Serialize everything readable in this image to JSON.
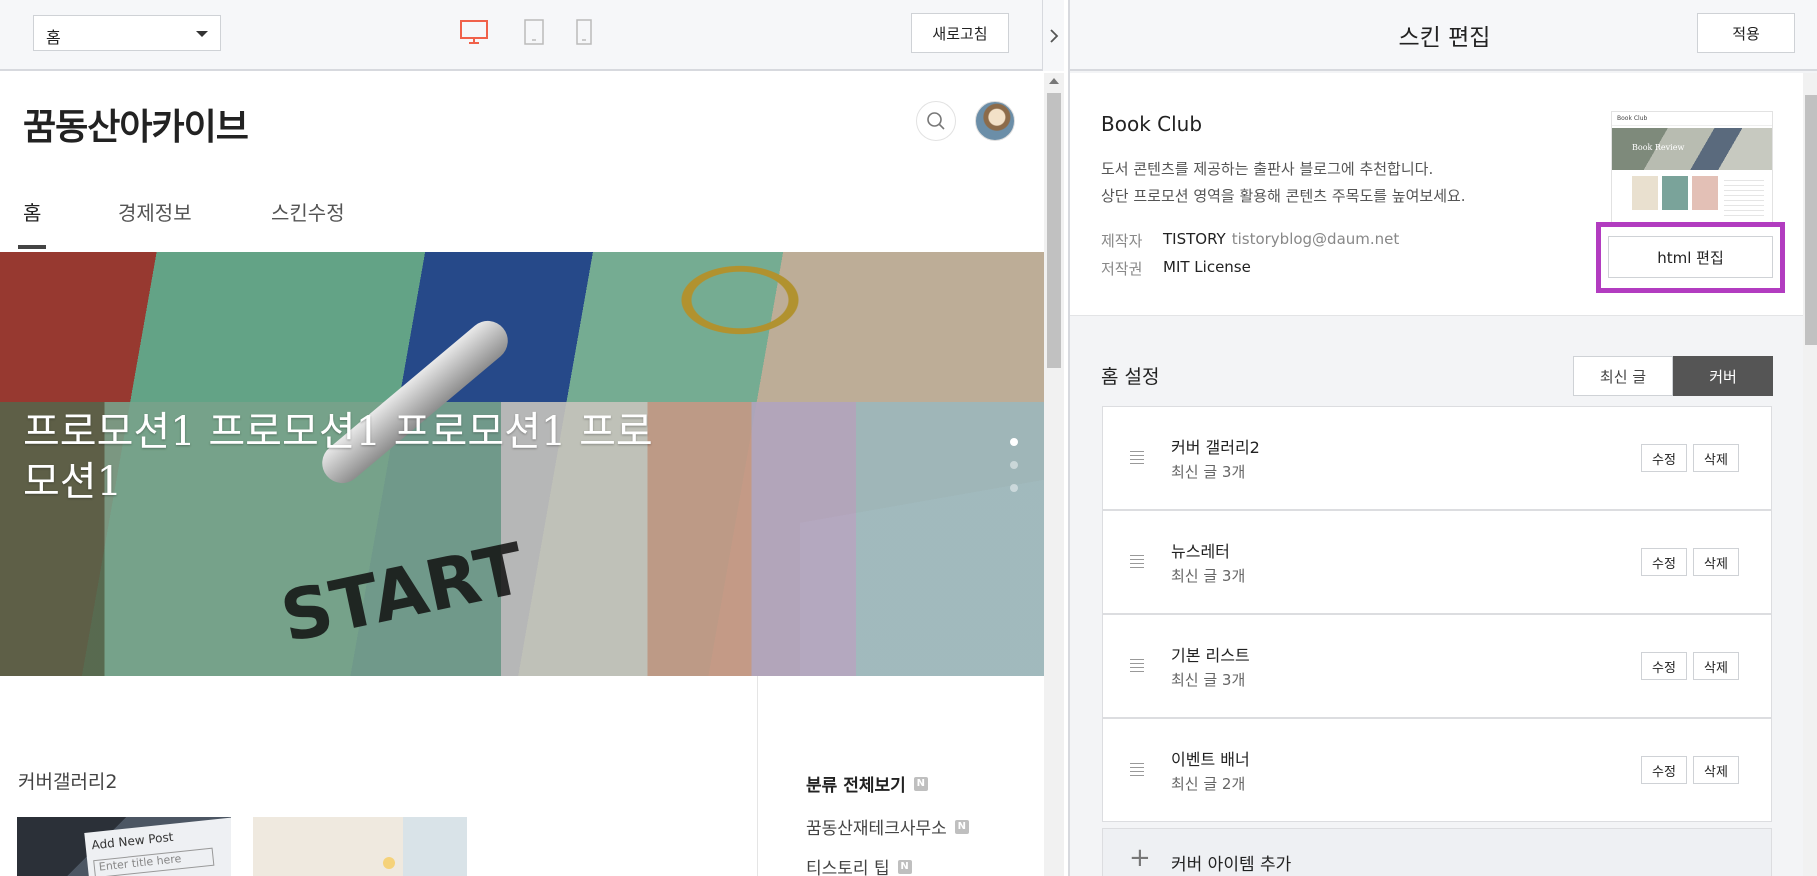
{
  "preview_toolbar": {
    "page_select": "홈",
    "refresh_label": "새로고침"
  },
  "blog": {
    "title": "꿈동산아카이브",
    "nav": [
      "홈",
      "경제정보",
      "스킨수정"
    ],
    "hero_text": "프로모션1 프로모션1 프로모션1 프로모션1",
    "hero_image_text": "START",
    "section_title": "커버갤러리2",
    "thumb_text": "Add New Post",
    "thumb_placeholder": "Enter title here",
    "categories": {
      "all": "분류 전체보기",
      "items": [
        "꿈동산재테크사무소",
        "티스토리 팁"
      ]
    },
    "badge": "N"
  },
  "editor": {
    "title": "스킨 편집",
    "apply_label": "적용",
    "skin": {
      "name": "Book Club",
      "desc_line1": "도서 콘텐츠를 제공하는 출판사 블로그에 추천합니다.",
      "desc_line2": "상단 프로모션 영역을 활용해 콘텐츠 주목도를 높여보세요.",
      "maker_label": "제작자",
      "maker_name": "TISTORY",
      "maker_email": "tistoryblog@daum.net",
      "license_label": "저작권",
      "license_value": "MIT License",
      "preview_title": "Book Club",
      "preview_hero": "Book Review",
      "html_edit_label": "html 편집"
    },
    "home": {
      "title": "홈 설정",
      "toggle": [
        "최신 글",
        "커버"
      ],
      "active_toggle": "커버",
      "edit_label": "수정",
      "delete_label": "삭제",
      "items": [
        {
          "name": "커버 갤러리2",
          "sub": "최신 글 3개"
        },
        {
          "name": "뉴스레터",
          "sub": "최신 글 3개"
        },
        {
          "name": "기본 리스트",
          "sub": "최신 글 3개"
        },
        {
          "name": "이벤트 배너",
          "sub": "최신 글 2개"
        }
      ],
      "add_label": "커버 아이템 추가"
    }
  },
  "colors": {
    "accent_device": "#f0614a",
    "highlight": "#b23cc0",
    "toggle_active": "#555555"
  }
}
